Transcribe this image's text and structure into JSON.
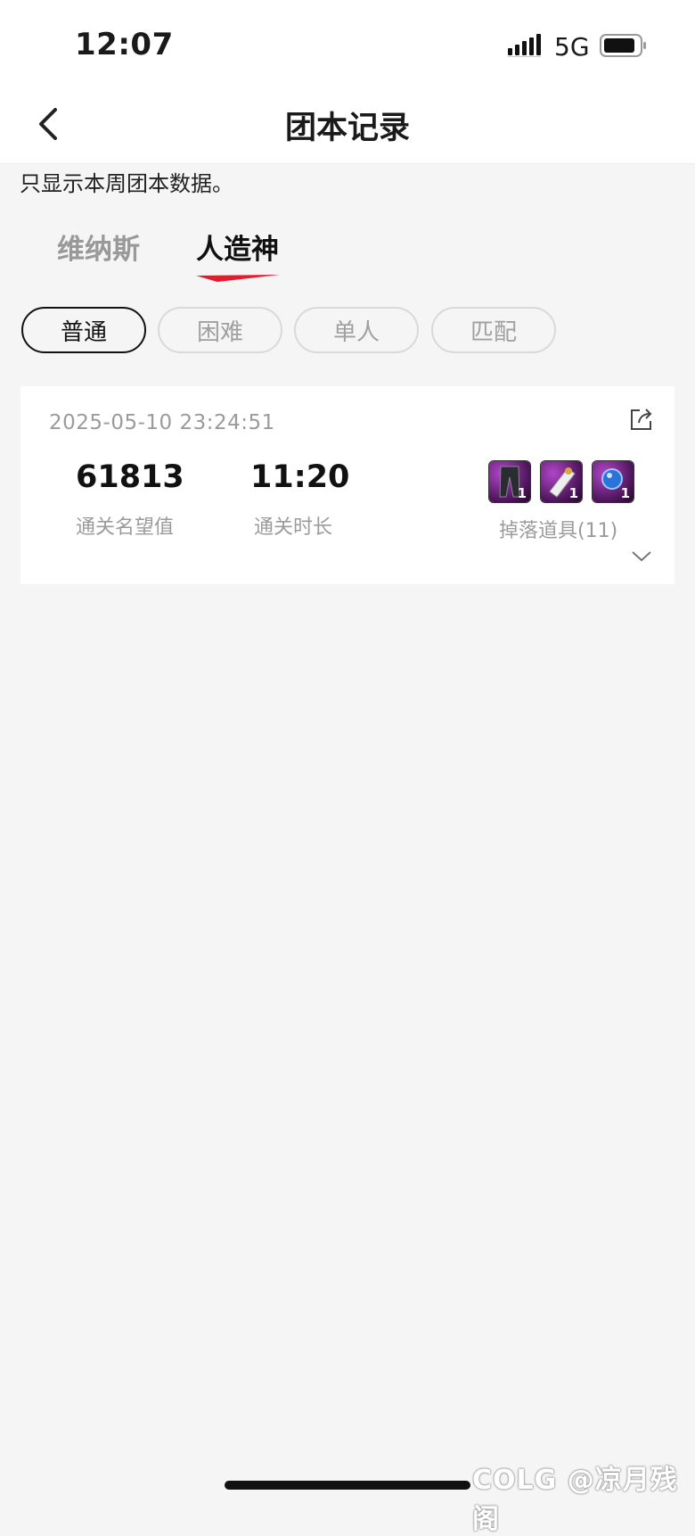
{
  "status_bar": {
    "time": "12:07",
    "network": "5G"
  },
  "nav": {
    "title": "团本记录"
  },
  "notice": "只显示本周团本数据。",
  "tabs": [
    {
      "label": "维纳斯",
      "active": false
    },
    {
      "label": "人造神",
      "active": true
    }
  ],
  "filters": [
    {
      "label": "普通",
      "active": true
    },
    {
      "label": "困难",
      "active": false
    },
    {
      "label": "单人",
      "active": false
    },
    {
      "label": "匹配",
      "active": false
    }
  ],
  "record": {
    "date": "2025-05-10 23:24:51",
    "reputation_value": "61813",
    "reputation_label": "通关名望值",
    "duration_value": "11:20",
    "duration_label": "通关时长",
    "items_label": "掉落道具(11)",
    "items": [
      {
        "icon": "dark-pants-item-icon",
        "qty": "1"
      },
      {
        "icon": "white-scroll-item-icon",
        "qty": "1"
      },
      {
        "icon": "blue-orb-item-icon",
        "qty": "1"
      }
    ]
  },
  "watermark": "COLG @凉月残阁",
  "colors": {
    "accent": "#e8192c",
    "background": "#f5f5f5"
  }
}
